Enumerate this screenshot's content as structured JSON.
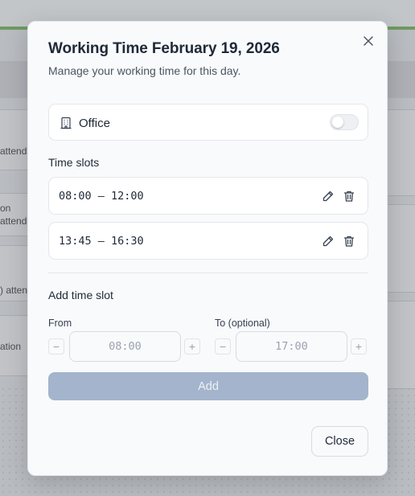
{
  "background": {
    "texts": [
      "attend",
      "on",
      "attend",
      ") atten",
      "ation"
    ]
  },
  "modal": {
    "title": "Working Time February 19, 2026",
    "subtitle": "Manage your working time for this day.",
    "close_icon": "close-icon",
    "office": {
      "icon": "building-icon",
      "label": "Office",
      "enabled": false
    },
    "time_slots": {
      "heading": "Time slots",
      "items": [
        {
          "label": "08:00 – 12:00",
          "edit_icon": "pencil-icon",
          "delete_icon": "trash-icon"
        },
        {
          "label": "13:45 – 16:30",
          "edit_icon": "pencil-icon",
          "delete_icon": "trash-icon"
        }
      ]
    },
    "add_slot": {
      "heading": "Add time slot",
      "from_label": "From",
      "from_placeholder": "08:00",
      "to_label": "To (optional)",
      "to_placeholder": "17:00",
      "decrement": "−",
      "increment": "+",
      "add_label": "Add"
    },
    "close_label": "Close"
  },
  "colors": {
    "accent_disabled": "#a3b4cc",
    "background_green": "#6f9a62"
  }
}
